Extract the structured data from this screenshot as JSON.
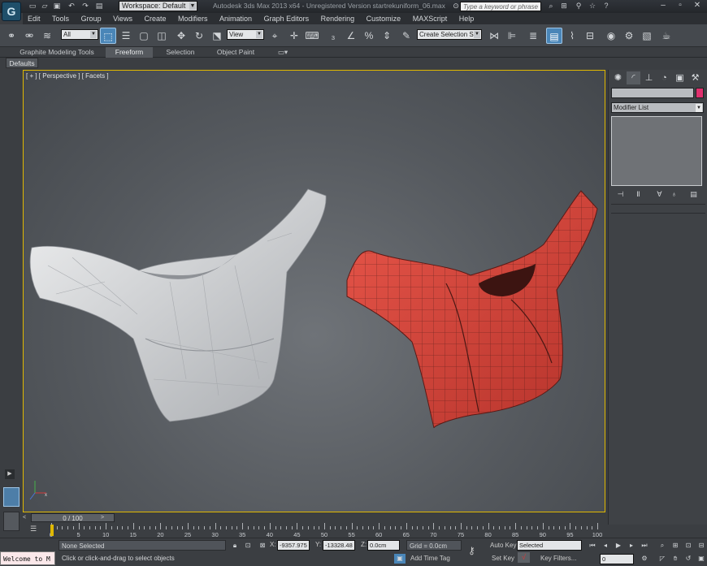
{
  "title_bar": {
    "app_icon": "3ds-max-logo-icon",
    "workspace": "Workspace: Default",
    "window_title": "Autodesk 3ds Max  2013 x64    - Unregistered Version    startrekuniform_06.max",
    "search_placeholder": "Type a keyword or phrase"
  },
  "menu": [
    "Edit",
    "Tools",
    "Group",
    "Views",
    "Create",
    "Modifiers",
    "Animation",
    "Graph Editors",
    "Rendering",
    "Customize",
    "MAXScript",
    "Help"
  ],
  "toolbar": {
    "selection_filter": "All",
    "reference_coord": "View",
    "named_selection": "Create Selection Se"
  },
  "ribbon": {
    "tabs": [
      "Graphite Modeling Tools",
      "Freeform",
      "Selection",
      "Object Paint"
    ],
    "active_tab": "Freeform",
    "defaults_label": "Defaults"
  },
  "viewport": {
    "label": "[ + ] [ Perspective ] [ Facets ]",
    "accent_color": "#e0b800",
    "objects": [
      {
        "name": "white-shirt-mesh",
        "color": "#d9dadc"
      },
      {
        "name": "red-shirt-mesh",
        "color": "#d9443a"
      }
    ]
  },
  "command_panel": {
    "modifier_list": "Modifier List",
    "object_color": "#e0306e"
  },
  "timeline": {
    "slider": "0 / 100",
    "ticks": [
      0,
      5,
      10,
      15,
      20,
      25,
      30,
      35,
      40,
      45,
      50,
      55,
      60,
      65,
      70,
      75,
      80,
      85,
      90,
      95,
      100
    ]
  },
  "status": {
    "maxscript": "Welcome to M",
    "selection": "None Selected",
    "prompt": "Click or click-and-drag to select objects",
    "x_label": "X:",
    "x": "-9357.975",
    "y_label": "Y:",
    "y": "-13328.48",
    "z_label": "Z:",
    "z": "0.0cm",
    "grid": "Grid = 0.0cm",
    "add_time_tag": "Add Time Tag",
    "auto_key": "Auto Key",
    "set_key": "Set Key",
    "key_mode": "Selected",
    "key_filters": "Key Filters...",
    "frame": "0"
  }
}
